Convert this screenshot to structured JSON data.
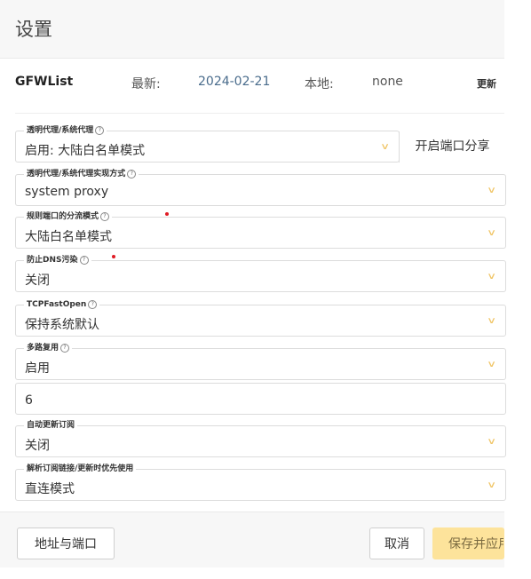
{
  "header": {
    "title": "设置"
  },
  "gfwlist": {
    "name": "GFWList",
    "latest_label": "最新:",
    "latest_date": "2024-02-21",
    "local_label": "本地:",
    "local_value": "none",
    "update_label": "更新"
  },
  "fields": {
    "proxy_mode": {
      "legend": "透明代理/系统代理",
      "value": "启用: 大陆白名单模式",
      "side_button": "开启端口分享"
    },
    "proxy_impl": {
      "legend": "透明代理/系统代理实现方式",
      "value": "system proxy"
    },
    "rule_port_mode": {
      "legend": "规则端口的分流模式",
      "value": "大陆白名单模式"
    },
    "dns_pollution": {
      "legend": "防止DNS污染",
      "value": "关闭"
    },
    "tcp_fast_open": {
      "legend": "TCPFastOpen",
      "value": "保持系统默认"
    },
    "mux": {
      "legend": "多路复用",
      "value": "启用",
      "concurrency": "6"
    },
    "auto_update": {
      "legend": "自动更新订阅",
      "value": "关闭"
    },
    "subscription_resolve": {
      "legend": "解析订阅链接/更新时优先使用",
      "value": "直连模式"
    }
  },
  "footer": {
    "address_button": "地址与端口",
    "cancel_button": "取消",
    "save_button": "保存并应用"
  },
  "colors": {
    "accent": "#fde39b",
    "chevron": "#f0c566",
    "date_blue": "#4a6c8c",
    "required_dot": "#e01b24"
  }
}
